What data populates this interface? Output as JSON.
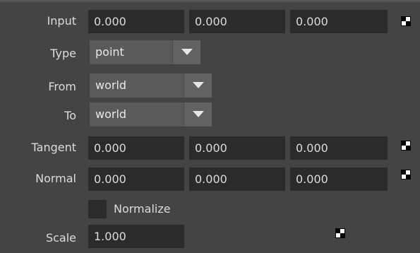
{
  "input": {
    "label": "Input",
    "x": "0.000",
    "y": "0.000",
    "z": "0.000"
  },
  "type": {
    "label": "Type",
    "value": "point"
  },
  "from": {
    "label": "From",
    "value": "world"
  },
  "to": {
    "label": "To",
    "value": "world"
  },
  "tangent": {
    "label": "Tangent",
    "x": "0.000",
    "y": "0.000",
    "z": "0.000"
  },
  "normal": {
    "label": "Normal",
    "x": "0.000",
    "y": "0.000",
    "z": "0.000"
  },
  "normalize": {
    "label": "Normalize",
    "checked": false
  },
  "scale": {
    "label": "Scale",
    "value": "1.000"
  },
  "icons": {
    "keyframe": "keyframe-icon",
    "dropdown": "chevron-down-icon"
  }
}
